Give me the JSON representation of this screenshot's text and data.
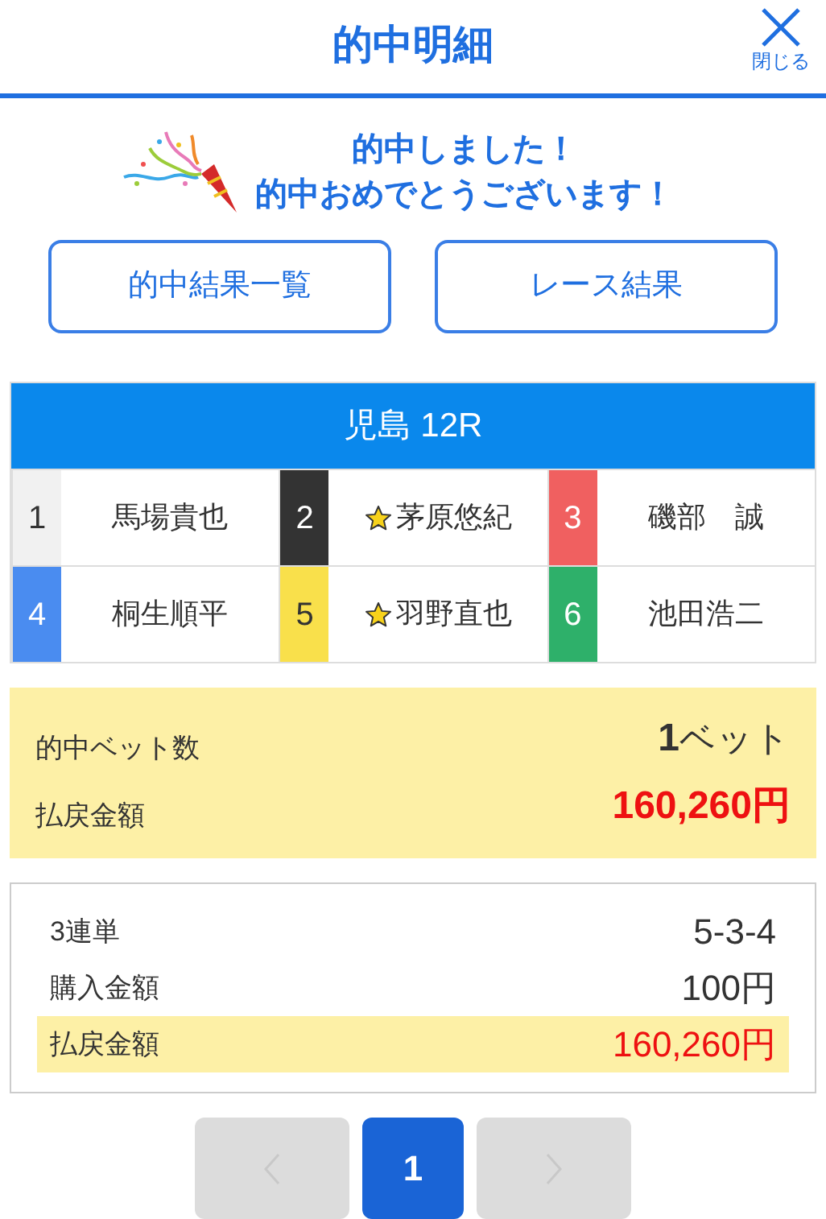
{
  "header": {
    "title": "的中明細",
    "close_label": "閉じる"
  },
  "congrats": {
    "lines": [
      "的中しました！",
      "的中おめでとうございます！"
    ]
  },
  "actions": [
    "的中結果一覧",
    "レース結果"
  ],
  "race": {
    "title": "児島 12R",
    "racers": [
      {
        "number": "1",
        "name": "馬場貴也",
        "color": "#f1f1f1",
        "star": false
      },
      {
        "number": "2",
        "name": "茅原悠紀",
        "color": "#333333",
        "star": true
      },
      {
        "number": "3",
        "name": "磯部　誠",
        "color": "#f06060",
        "star": false
      },
      {
        "number": "4",
        "name": "桐生順平",
        "color": "#4a8cf0",
        "star": false
      },
      {
        "number": "5",
        "name": "羽野直也",
        "color": "#f9e04b",
        "star": true
      },
      {
        "number": "6",
        "name": "池田浩二",
        "color": "#2eb06a",
        "star": false
      }
    ]
  },
  "summary": {
    "bet_count_label": "的中ベット数",
    "bet_count_number": "1",
    "bet_count_unit": "ベット",
    "payout_label": "払戻金額",
    "payout_value": "160,260円"
  },
  "details": [
    {
      "label": "3連単",
      "value": "5-3-4",
      "highlighted": false
    },
    {
      "label": "購入金額",
      "value": "100円",
      "highlighted": false
    },
    {
      "label": "払戻金額",
      "value": "160,260円",
      "highlighted": true
    }
  ],
  "pagination": {
    "prev_disabled": true,
    "next_disabled": true,
    "pages": [
      {
        "label": "1",
        "selected": true
      }
    ]
  }
}
